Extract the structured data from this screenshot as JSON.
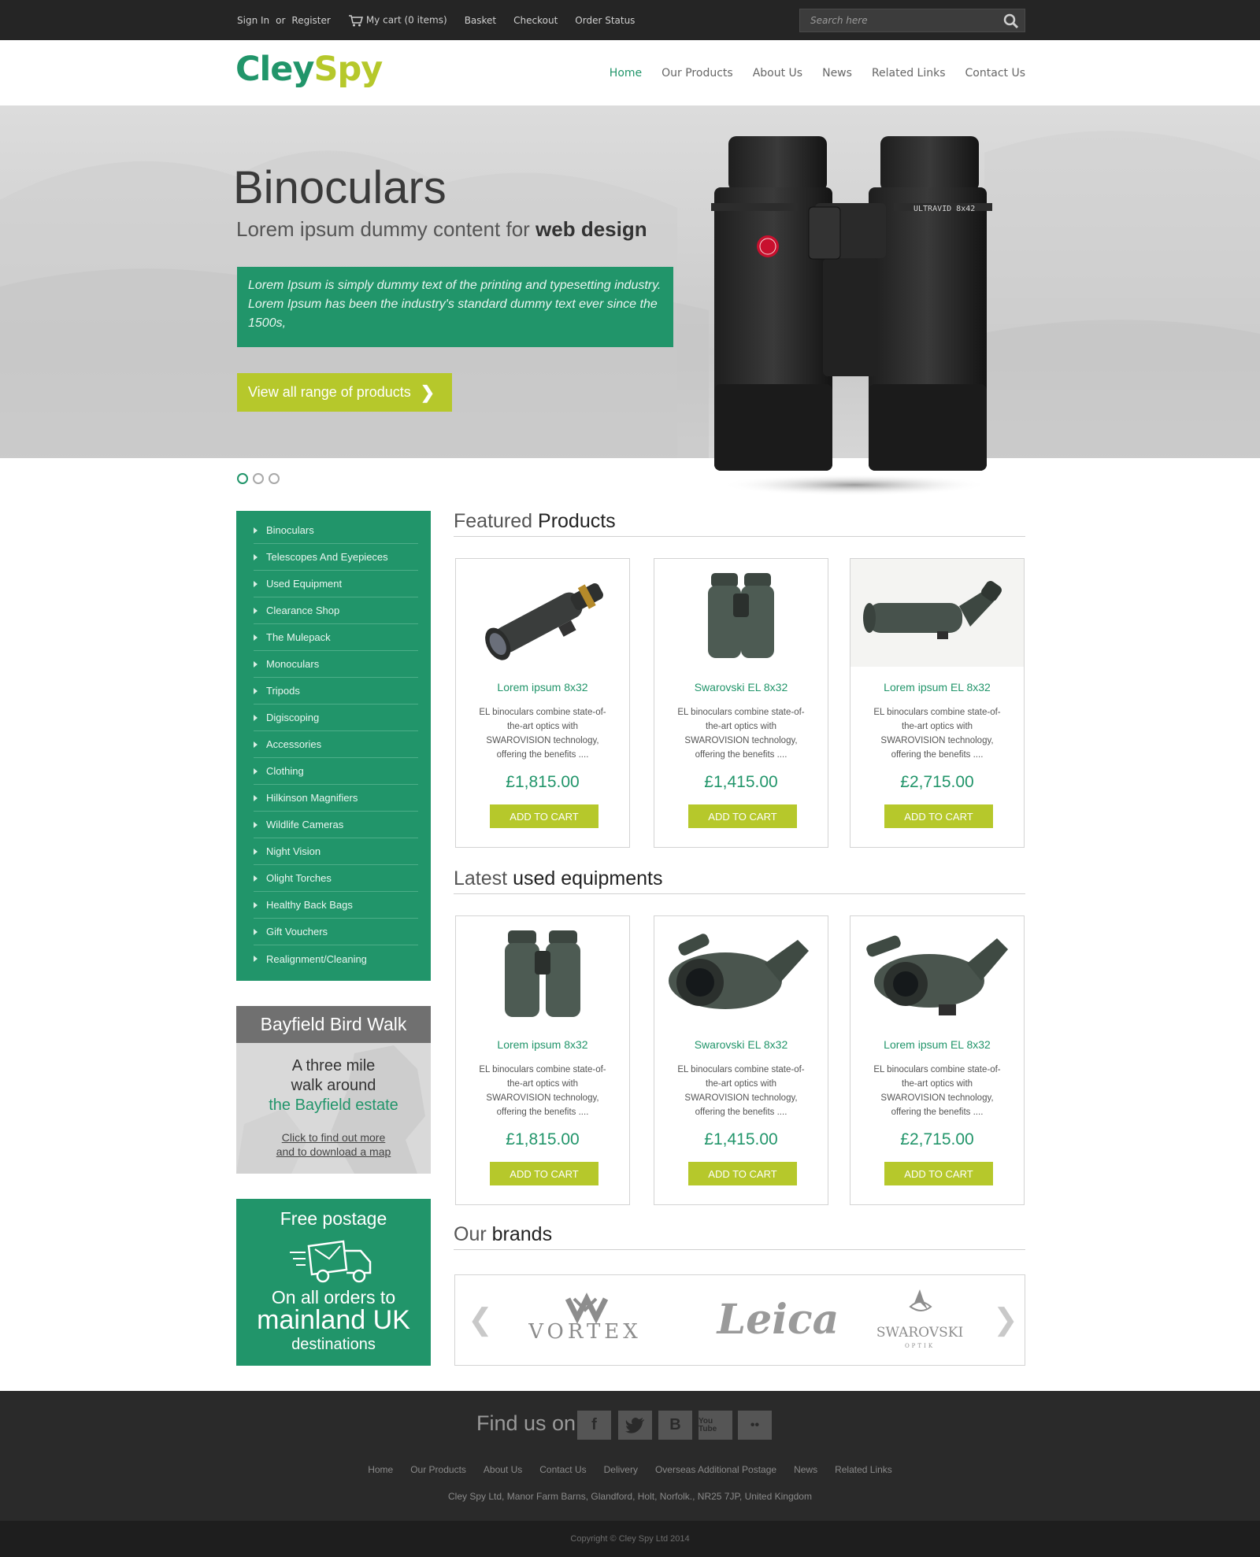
{
  "topbar": {
    "signin": "Sign In",
    "or": "or",
    "register": "Register",
    "cart": "My cart (0 items)",
    "basket": "Basket",
    "checkout": "Checkout",
    "order_status": "Order Status",
    "search_placeholder": "Search here"
  },
  "header": {
    "logo_part1": "Cley",
    "logo_part2": "Spy",
    "nav": [
      "Home",
      "Our Products",
      "About Us",
      "News",
      "Related Links",
      "Contact Us"
    ],
    "active_nav": "Home"
  },
  "hero": {
    "title": "Binoculars",
    "subtitle_plain": "Lorem ipsum dummy content for ",
    "subtitle_bold": "web design",
    "box_text": "Lorem Ipsum is simply dummy text of the printing and typesetting industry. Lorem Ipsum has been the industry's standard dummy text ever since the 1500s,",
    "button_label": "View all range of products",
    "button_arrow": "❯",
    "product_label": "ULTRAVID 8x42",
    "slide_count": 3,
    "active_slide": 1
  },
  "categories": [
    "Binoculars",
    "Telescopes And Eyepieces",
    "Used Equipment",
    "Clearance Shop",
    "The Mulepack",
    "Monoculars",
    "Tripods",
    "Digiscoping",
    "Accessories",
    "Clothing",
    "Hilkinson Magnifiers",
    "Wildlife Cameras",
    "Night Vision",
    "Olight Torches",
    "Healthy Back Bags",
    "Gift Vouchers",
    "Realignment/Cleaning"
  ],
  "walk": {
    "title": "Bayfield Bird Walk",
    "line1": "A three mile",
    "line2": "walk around",
    "line3": "the Bayfield estate",
    "link1": "Click to find out more",
    "link2": "and to download a map"
  },
  "postage": {
    "line1": "Free postage",
    "line2": "On all orders to",
    "line3": "mainland UK",
    "line4": "destinations"
  },
  "featured": {
    "title_plain": "Featured ",
    "title_bold": "Products",
    "products": [
      {
        "name": "Lorem ipsum 8x32",
        "desc": "EL binoculars combine state-of-the-art optics with SWAROVISION technology, offering the benefits ....",
        "price": "£1,815.00",
        "button": "ADD TO CART",
        "icon": "spotting-scope"
      },
      {
        "name": "Swarovski EL 8x32",
        "desc": "EL binoculars combine state-of-the-art optics with SWAROVISION technology, offering the benefits ....",
        "price": "£1,415.00",
        "button": "ADD TO CART",
        "icon": "binoculars"
      },
      {
        "name": "Lorem ipsum EL 8x32",
        "desc": "EL binoculars combine state-of-the-art optics with SWAROVISION technology, offering the benefits ....",
        "price": "£2,715.00",
        "button": "ADD TO CART",
        "icon": "spotting-scope"
      }
    ]
  },
  "used": {
    "title_plain": "Latest ",
    "title_bold": "used equipments",
    "products": [
      {
        "name": "Lorem ipsum 8x32",
        "desc": "EL binoculars combine state-of-the-art optics with SWAROVISION technology, offering the benefits ....",
        "price": "£1,815.00",
        "button": "ADD TO CART",
        "icon": "binoculars"
      },
      {
        "name": "Swarovski EL 8x32",
        "desc": "EL binoculars combine state-of-the-art optics with SWAROVISION technology, offering the benefits ....",
        "price": "£1,415.00",
        "button": "ADD TO CART",
        "icon": "spotting-scope"
      },
      {
        "name": "Lorem ipsum EL 8x32",
        "desc": "EL binoculars combine state-of-the-art optics with SWAROVISION technology, offering the benefits ....",
        "price": "£2,715.00",
        "button": "ADD TO CART",
        "icon": "spotting-scope"
      }
    ]
  },
  "brands": {
    "title_plain": "Our ",
    "title_bold": "brands",
    "prev": "❮",
    "next": "❯",
    "items": [
      "VORTEX",
      "Leica",
      "SWAROVSKI",
      "OPTIK"
    ]
  },
  "footer": {
    "find_us": "Find us on",
    "social": [
      "facebook-icon",
      "twitter-icon",
      "blogger-icon",
      "youtube-icon",
      "flickr-icon"
    ],
    "social_glyphs": {
      "facebook": "f",
      "blogger": "B",
      "youtube": "You Tube",
      "flickr": "••"
    },
    "links": [
      "Home",
      "Our Products",
      "About Us",
      "Contact Us",
      "Delivery",
      "Overseas Additional Postage",
      "News",
      "Related Links"
    ],
    "address": "Cley Spy Ltd, Manor Farm Barns, Glandford, Holt, Norfolk., NR25 7JP, United Kingdom",
    "copyright": "Copyright © Cley Spy Ltd 2014"
  },
  "colors": {
    "brand_green": "#21956a",
    "brand_lime": "#b6c82b",
    "topbar_bg": "#252525",
    "footer_bg": "#2a2a2a"
  }
}
